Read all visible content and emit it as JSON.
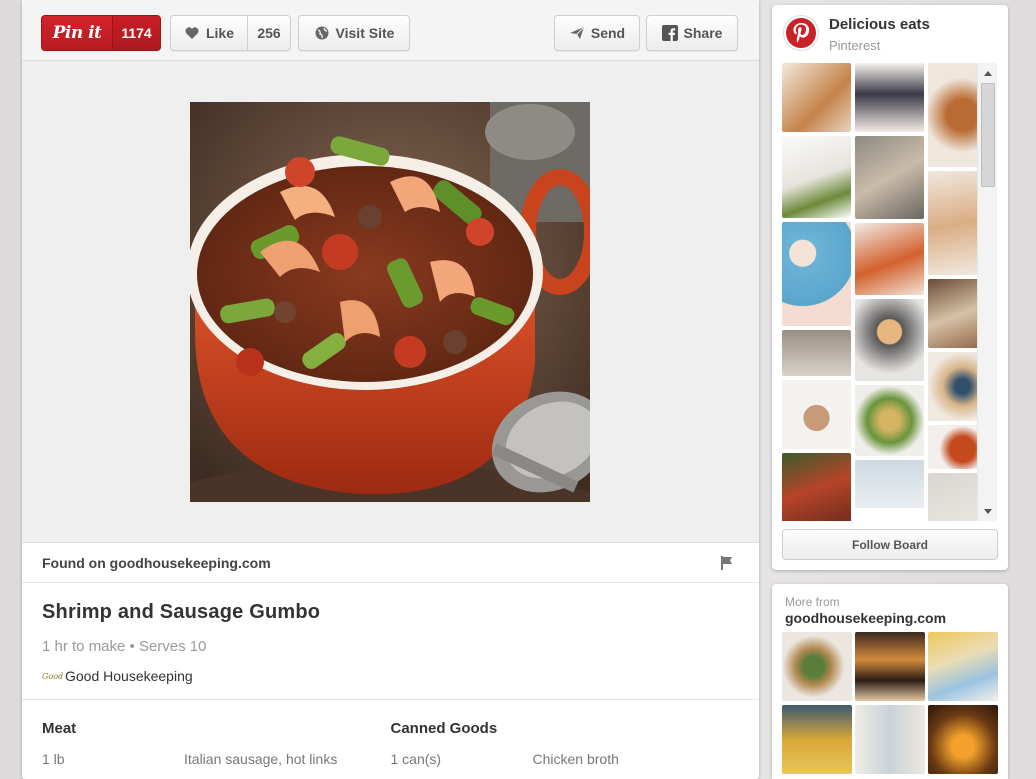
{
  "colors": {
    "pinterest_red": "#cb2027",
    "background": "#e4e2e2",
    "card": "#ffffff"
  },
  "toolbar": {
    "pin_label": "Pin it",
    "pin_count": "1174",
    "like_label": "Like",
    "like_count": "256",
    "visit_label": "Visit Site",
    "send_label": "Send",
    "share_label": "Share"
  },
  "pin": {
    "found_on": "Found on goodhousekeeping.com",
    "title": "Shrimp and Sausage Gumbo",
    "meta": "1 hr to make • Serves 10",
    "source_logo": "Good",
    "source_name": "Good Housekeeping"
  },
  "ingredients": [
    {
      "heading": "Meat",
      "qty": "1 lb",
      "item": "Italian sausage, hot links"
    },
    {
      "heading": "Canned Goods",
      "qty": "1 can(s)",
      "item": "Chicken broth"
    }
  ],
  "board": {
    "name": "Delicious eats",
    "owner": "Pinterest",
    "follow_label": "Follow Board"
  },
  "more_from": {
    "label": "More from",
    "site": "goodhousekeeping.com"
  }
}
